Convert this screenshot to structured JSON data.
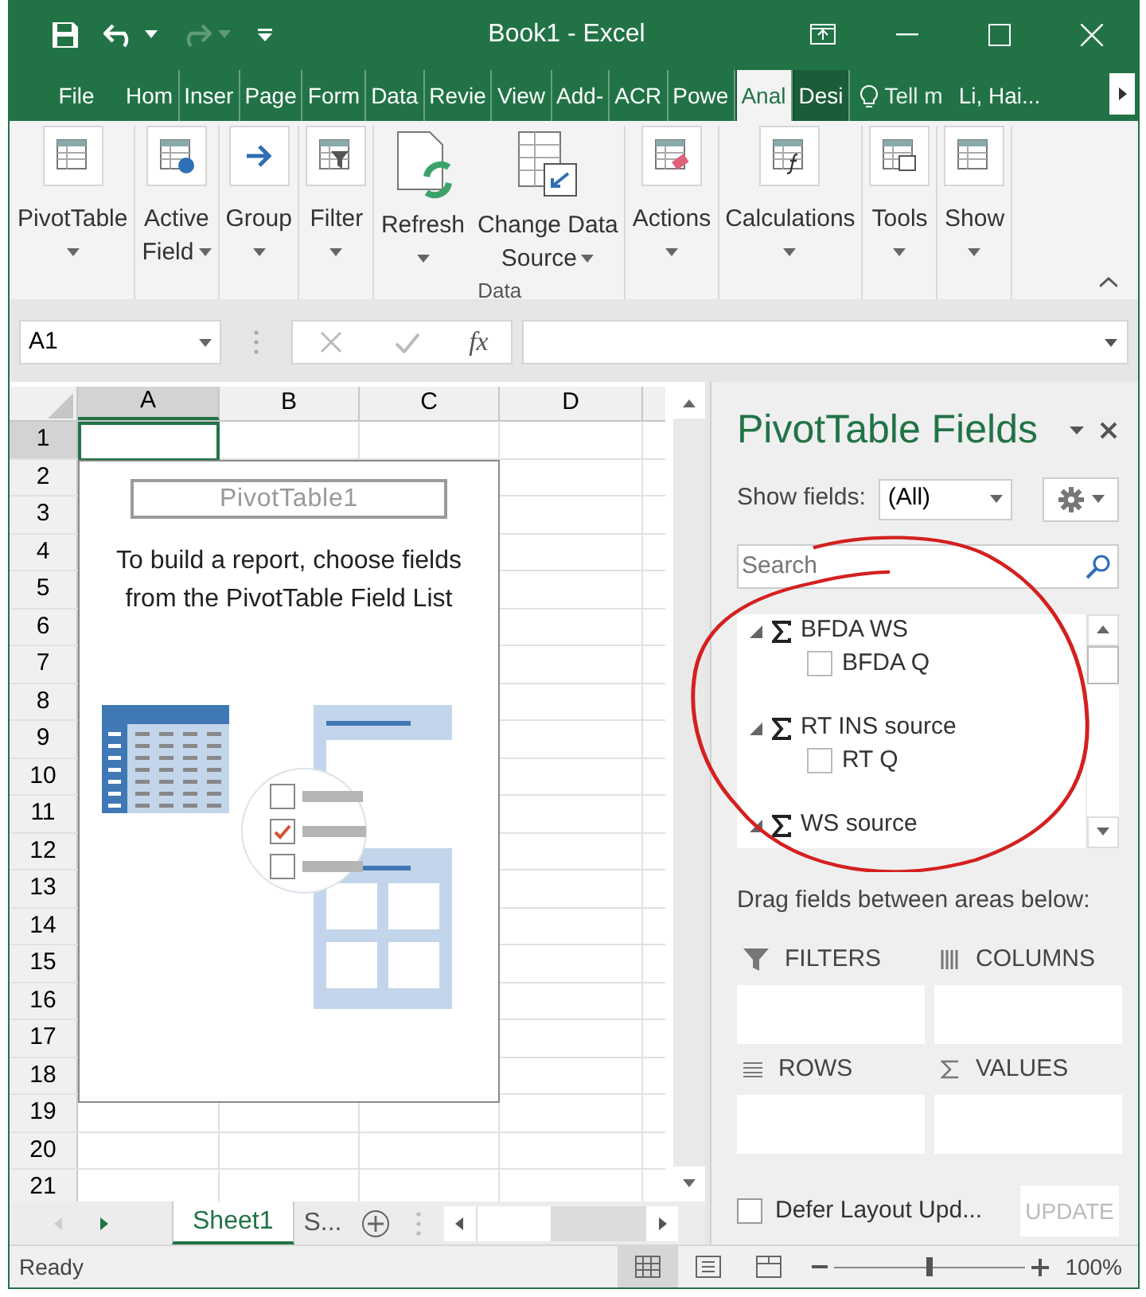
{
  "window": {
    "title": "Book1 - Excel"
  },
  "quick_access": [
    {
      "kind": "save",
      "disabled": false
    },
    {
      "kind": "undo",
      "disabled": false
    },
    {
      "kind": "redo",
      "disabled": true
    },
    {
      "kind": "customize",
      "disabled": false
    }
  ],
  "tabs": [
    {
      "label": "File",
      "selected": false,
      "contextual": false
    },
    {
      "label": "Hom",
      "selected": false,
      "contextual": false
    },
    {
      "label": "Inser",
      "selected": false,
      "contextual": false
    },
    {
      "label": "Page",
      "selected": false,
      "contextual": false
    },
    {
      "label": "Form",
      "selected": false,
      "contextual": false
    },
    {
      "label": "Data",
      "selected": false,
      "contextual": false
    },
    {
      "label": "Revie",
      "selected": false,
      "contextual": false
    },
    {
      "label": "View",
      "selected": false,
      "contextual": false
    },
    {
      "label": "Add-",
      "selected": false,
      "contextual": false
    },
    {
      "label": "ACR",
      "selected": false,
      "contextual": false
    },
    {
      "label": "Powe",
      "selected": false,
      "contextual": false
    },
    {
      "label": "Anal",
      "selected": true,
      "contextual": true
    },
    {
      "label": "Desi",
      "selected": false,
      "contextual": true
    }
  ],
  "tell_me": "Tell m",
  "user": "Li, Hai...",
  "ribbon": {
    "groups": [
      {
        "buttons": [
          {
            "lines": [
              "PivotTable"
            ],
            "kind": "framed",
            "dropdown": true
          }
        ]
      },
      {
        "buttons": [
          {
            "lines": [
              "Active",
              "Field"
            ],
            "kind": "framed",
            "dropdown": true
          }
        ]
      },
      {
        "buttons": [
          {
            "lines": [
              "Group"
            ],
            "kind": "framed",
            "dropdown": true
          }
        ]
      },
      {
        "buttons": [
          {
            "lines": [
              "Filter"
            ],
            "kind": "framed",
            "dropdown": true
          }
        ]
      },
      {
        "label": "Data",
        "buttons": [
          {
            "lines": [
              "Refresh"
            ],
            "kind": "large",
            "dropdown": true
          },
          {
            "lines": [
              "Change Data",
              "Source"
            ],
            "kind": "large",
            "dropdown": true
          }
        ]
      },
      {
        "buttons": [
          {
            "lines": [
              "Actions"
            ],
            "kind": "framed",
            "dropdown": true
          }
        ]
      },
      {
        "buttons": [
          {
            "lines": [
              "Calculations"
            ],
            "kind": "framed",
            "dropdown": true
          }
        ]
      },
      {
        "buttons": [
          {
            "lines": [
              "Tools"
            ],
            "kind": "framed",
            "dropdown": true
          }
        ]
      },
      {
        "buttons": [
          {
            "lines": [
              "Show"
            ],
            "kind": "framed",
            "dropdown": true
          }
        ]
      }
    ]
  },
  "formula_bar": {
    "name_box": "A1",
    "function_label": "fx"
  },
  "grid": {
    "columns": [
      {
        "label": "A",
        "selected": true
      },
      {
        "label": "B",
        "selected": false
      },
      {
        "label": "C",
        "selected": false
      },
      {
        "label": "D",
        "selected": false
      }
    ],
    "rows": [
      {
        "label": "1",
        "selected": true
      },
      {
        "label": "2",
        "selected": false
      },
      {
        "label": "3",
        "selected": false
      },
      {
        "label": "4",
        "selected": false
      },
      {
        "label": "5",
        "selected": false
      },
      {
        "label": "6",
        "selected": false
      },
      {
        "label": "7",
        "selected": false
      },
      {
        "label": "8",
        "selected": false
      },
      {
        "label": "9",
        "selected": false
      },
      {
        "label": "10",
        "selected": false
      },
      {
        "label": "11",
        "selected": false
      },
      {
        "label": "12",
        "selected": false
      },
      {
        "label": "13",
        "selected": false
      },
      {
        "label": "14",
        "selected": false
      },
      {
        "label": "15",
        "selected": false
      },
      {
        "label": "16",
        "selected": false
      },
      {
        "label": "17",
        "selected": false
      },
      {
        "label": "18",
        "selected": false
      },
      {
        "label": "19",
        "selected": false
      },
      {
        "label": "20",
        "selected": false
      },
      {
        "label": "21",
        "selected": false
      }
    ]
  },
  "pivot_placeholder": {
    "name": "PivotTable1",
    "instructions": [
      "To build a report, choose fields",
      "from the PivotTable Field List"
    ]
  },
  "sheet_tabs": [
    {
      "label": "Sheet1",
      "selected": true
    },
    {
      "label": "S...",
      "selected": false
    }
  ],
  "field_pane": {
    "title": "PivotTable Fields",
    "show_fields_label": "Show fields:",
    "show_fields_value": "(All)",
    "search": {
      "placeholder": "Search"
    },
    "fields": [
      {
        "name": "BFDA WS",
        "expanded": true,
        "children": [
          {
            "name": "BFDA Q",
            "checked": false
          }
        ]
      },
      {
        "name": "RT INS source",
        "expanded": true,
        "children": [
          {
            "name": "RT Q",
            "checked": false
          }
        ]
      },
      {
        "name": "WS source",
        "expanded": true
      }
    ],
    "areas_hint": "Drag fields between areas below:",
    "areas": [
      {
        "label": "FILTERS",
        "kind": "filters"
      },
      {
        "label": "COLUMNS",
        "kind": "columns"
      },
      {
        "label": "ROWS",
        "kind": "rows"
      },
      {
        "label": "VALUES",
        "kind": "values"
      }
    ],
    "defer": {
      "label": "Defer Layout Upd...",
      "checked": false
    },
    "update": {
      "label": "UPDATE",
      "disabled": true
    }
  },
  "status_bar": {
    "text": "Ready",
    "views": [
      {
        "selected": true
      },
      {
        "selected": false
      },
      {
        "selected": false
      }
    ],
    "zoom": {
      "level": 0.5,
      "reading": "100%"
    }
  }
}
